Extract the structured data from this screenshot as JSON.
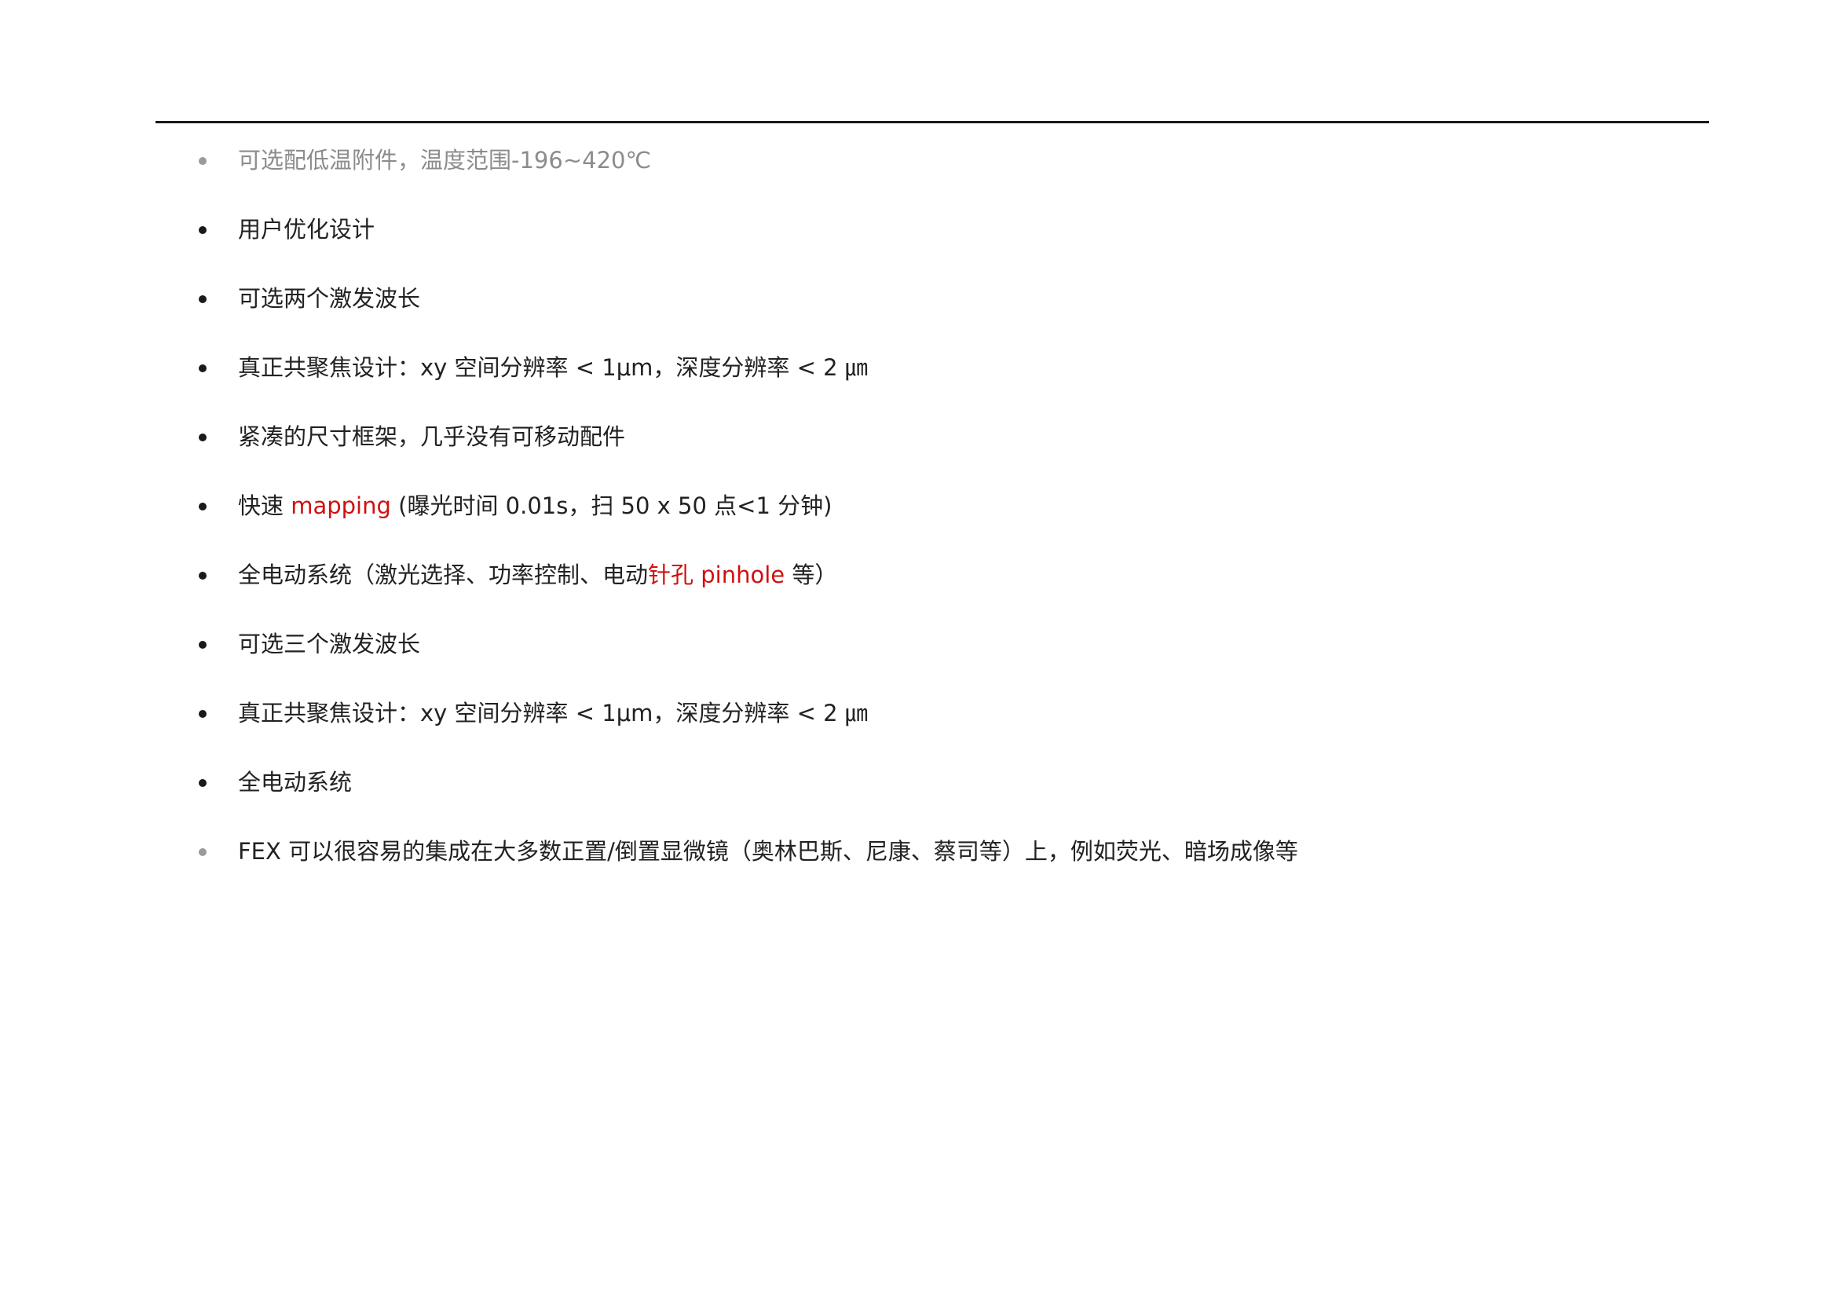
{
  "colors": {
    "text": "#222222",
    "muted_text": "#8c8c8c",
    "highlight": "#d01010",
    "rule": "#1a1a1a"
  },
  "items": [
    {
      "text": "可选配低温附件，温度范围-196~420℃"
    },
    {
      "text": "用户优化设计"
    },
    {
      "text": "可选两个激发波长"
    },
    {
      "text": "真正共聚焦设计：xy 空间分辨率 < 1μm，深度分辨率 < 2 ㎛"
    },
    {
      "text": "紧凑的尺寸框架，几乎没有可移动配件"
    },
    {
      "pre": "快速 ",
      "red": "mapping",
      "post": " (曝光时间 0.01s，扫 50 x 50 点<1 分钟)"
    },
    {
      "pre": "全电动系统（激光选择、功率控制、电动",
      "red": "针孔 pinhole",
      "post": " 等）"
    },
    {
      "text": "可选三个激发波长"
    },
    {
      "text": "真正共聚焦设计：xy 空间分辨率 < 1μm，深度分辨率 < 2 ㎛"
    },
    {
      "text": "全电动系统"
    },
    {
      "text": "FEX 可以很容易的集成在大多数正置/倒置显微镜（奥林巴斯、尼康、蔡司等）上，例如荧光、暗场成像等"
    }
  ]
}
